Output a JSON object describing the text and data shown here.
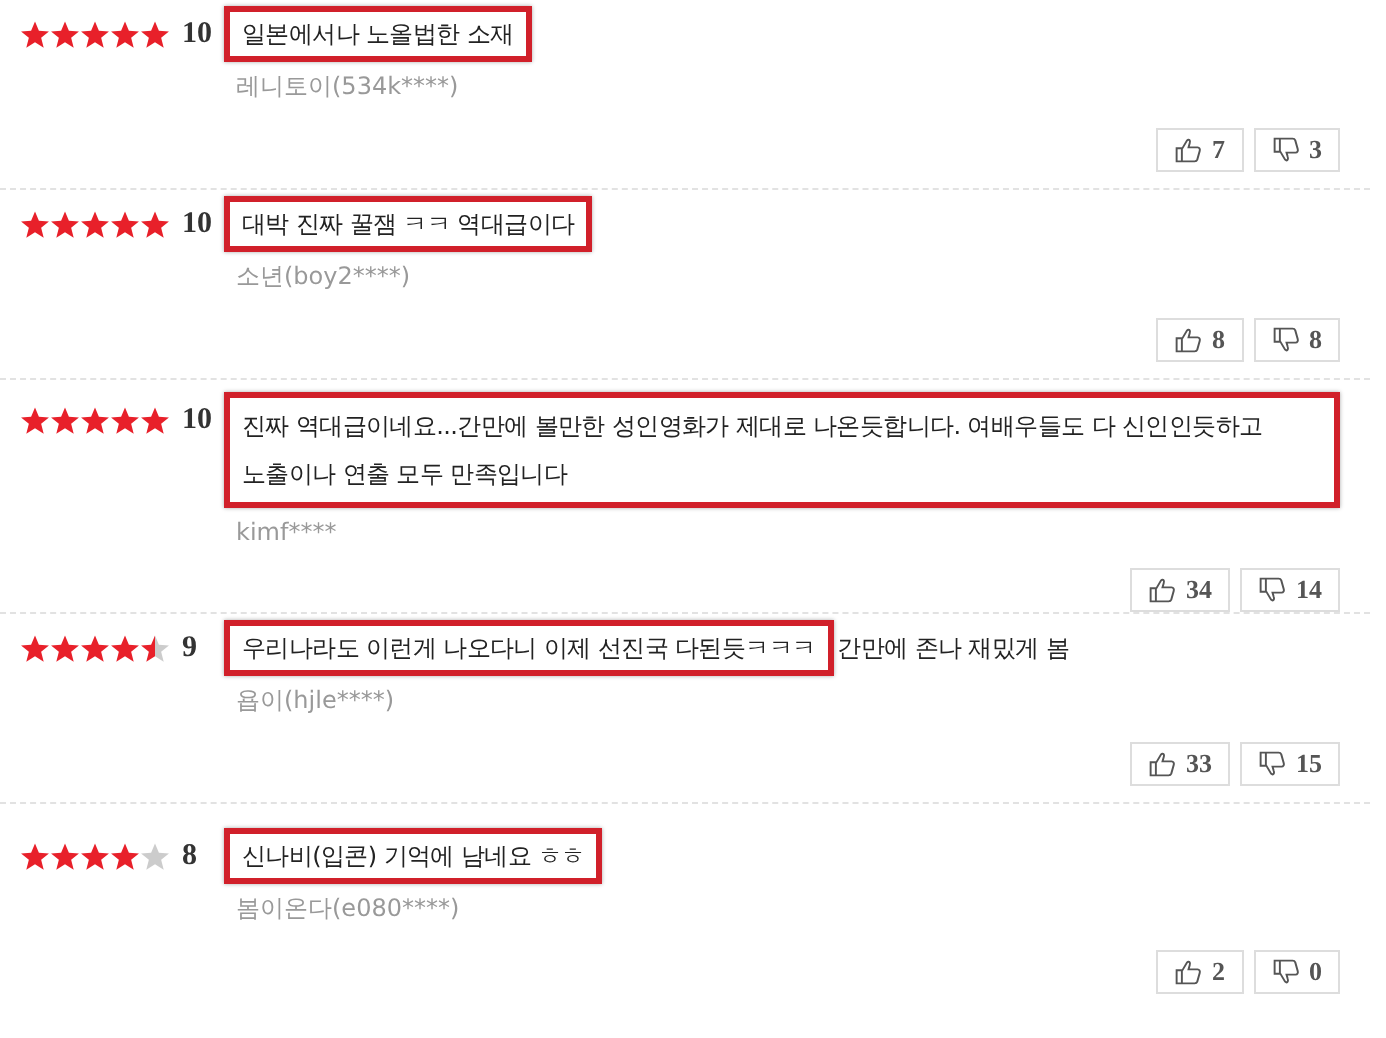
{
  "reviews": [
    {
      "stars": 5,
      "score": "10",
      "highlighted": "일본에서나 노올법한 소재",
      "author": "레니토이(534k****)",
      "likes": "7",
      "dislikes": "3"
    },
    {
      "stars": 5,
      "score": "10",
      "highlighted": "대박 진짜 꿀잼 ㅋㅋ 역대급이다",
      "author": "소년(boy2****)",
      "likes": "8",
      "dislikes": "8"
    },
    {
      "stars": 5,
      "score": "10",
      "highlighted": "진짜 역대급이네요...간만에 볼만한 성인영화가 제대로 나온듯합니다. 여배우들도 다 신인인듯하고 노출이나 연출 모두 만족입니다",
      "author": "kimf****",
      "likes": "34",
      "dislikes": "14"
    },
    {
      "stars": 4.5,
      "score": "9",
      "highlighted": "우리나라도 이런게 나오다니 이제 선진국 다된듯ㅋㅋㅋ",
      "rest": "간만에 존나 재밌게 봄",
      "author": "욥이(hjle****)",
      "likes": "33",
      "dislikes": "15"
    },
    {
      "stars": 4,
      "score": "8",
      "highlighted": "신나비(입콘) 기억에 남네요 ㅎㅎ",
      "author": "봄이온다(e080****)",
      "likes": "2",
      "dislikes": "0"
    }
  ]
}
